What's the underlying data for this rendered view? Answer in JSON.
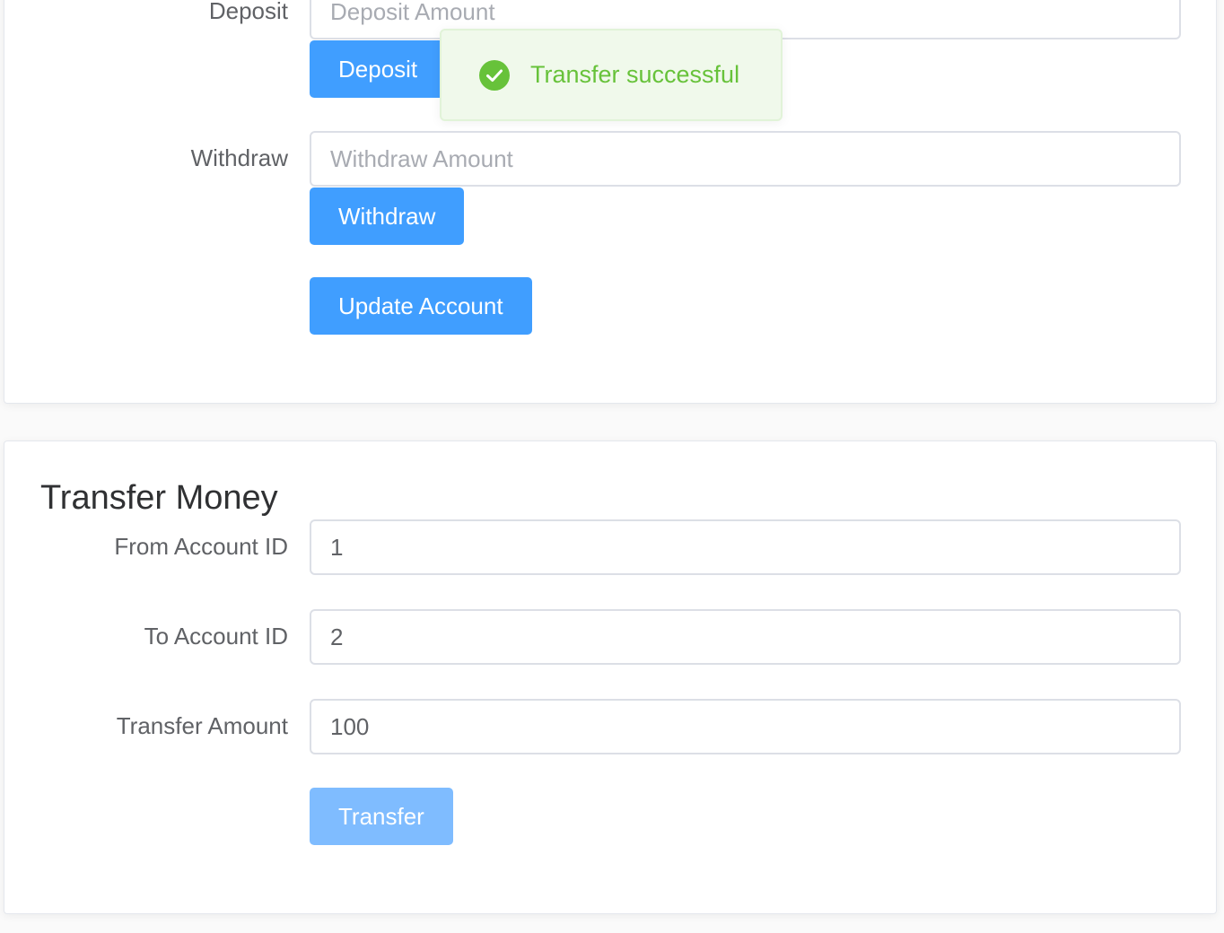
{
  "account_card": {
    "deposit": {
      "label": "Deposit",
      "placeholder": "Deposit Amount",
      "button_label": "Deposit"
    },
    "withdraw": {
      "label": "Withdraw",
      "placeholder": "Withdraw Amount",
      "button_label": "Withdraw"
    },
    "update_button_label": "Update Account"
  },
  "transfer_card": {
    "title": "Transfer Money",
    "from_account": {
      "label": "From Account ID",
      "value": "1"
    },
    "to_account": {
      "label": "To Account ID",
      "value": "2"
    },
    "amount": {
      "label": "Transfer Amount",
      "value": "100"
    },
    "button_label": "Transfer",
    "button_disabled": true
  },
  "toast": {
    "message": "Transfer successful",
    "type": "success",
    "icon": "check-circle-icon"
  },
  "colors": {
    "primary": "#409eff",
    "primary_disabled": "#7fbcff",
    "success": "#67c23a",
    "success_bg": "#f0f9eb"
  }
}
